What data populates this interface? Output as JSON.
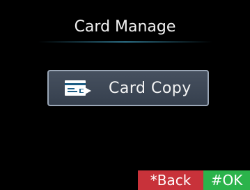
{
  "header": {
    "title": "Card Manage"
  },
  "menu": {
    "items": [
      {
        "label": "Card Copy",
        "icon": "card-copy-icon",
        "selected": true
      }
    ]
  },
  "softkeys": {
    "back_label": "*Back",
    "ok_label": "#OK"
  },
  "colors": {
    "background": "#000000",
    "back_key": "#c8323a",
    "ok_key": "#2bb34b",
    "button_border": "#9aa6b6",
    "button_fill": "#3e4856",
    "divider": "#2c6f86"
  }
}
